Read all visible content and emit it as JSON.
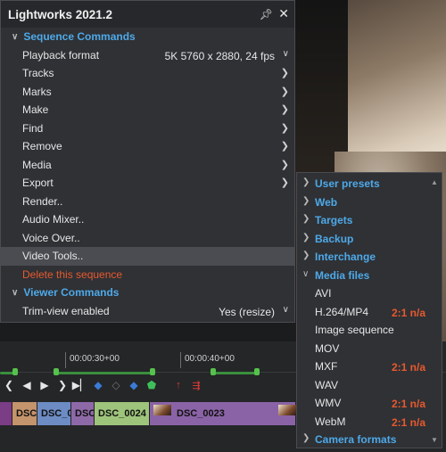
{
  "window": {
    "title": "Lightworks 2021.2"
  },
  "menu": {
    "sequence_header": "Sequence Commands",
    "playback_format": {
      "label": "Playback format",
      "value": "5K 5760 x 2880, 24 fps"
    },
    "items": [
      {
        "label": "Tracks",
        "submenu": true
      },
      {
        "label": "Marks",
        "submenu": true
      },
      {
        "label": "Make",
        "submenu": true
      },
      {
        "label": "Find",
        "submenu": true
      },
      {
        "label": "Remove",
        "submenu": true
      },
      {
        "label": "Media",
        "submenu": true
      },
      {
        "label": "Export",
        "submenu": true
      },
      {
        "label": "Render..",
        "submenu": false
      },
      {
        "label": "Audio Mixer..",
        "submenu": false
      },
      {
        "label": "Voice Over..",
        "submenu": false
      },
      {
        "label": "Video Tools..",
        "submenu": false
      }
    ],
    "delete_label": "Delete this sequence",
    "viewer_header": "Viewer Commands",
    "trim_view": {
      "label": "Trim-view enabled",
      "value": "Yes (resize)"
    }
  },
  "submenu": {
    "sections_top": [
      "User presets",
      "Web",
      "Targets",
      "Backup",
      "Interchange"
    ],
    "media_header": "Media files",
    "media_items": [
      {
        "label": "AVI",
        "badge": ""
      },
      {
        "label": "H.264/MP4",
        "badge": "2:1 n/a"
      },
      {
        "label": "Image sequence",
        "badge": ""
      },
      {
        "label": "MOV",
        "badge": ""
      },
      {
        "label": "MXF",
        "badge": "2:1 n/a"
      },
      {
        "label": "WAV",
        "badge": ""
      },
      {
        "label": "WMV",
        "badge": "2:1 n/a"
      },
      {
        "label": "WebM",
        "badge": "2:1 n/a"
      }
    ],
    "camera_header": "Camera formats"
  },
  "timeline": {
    "timecodes": [
      "00:00:30+00",
      "00:00:40+00"
    ],
    "clips": [
      "DSC_",
      "DSC_0",
      "DSC",
      "DSC_0024",
      "DSC_0023"
    ]
  },
  "colors": {
    "accent": "#4ea9e8",
    "danger": "#e8592d",
    "menu_bg": "#2f3135"
  }
}
